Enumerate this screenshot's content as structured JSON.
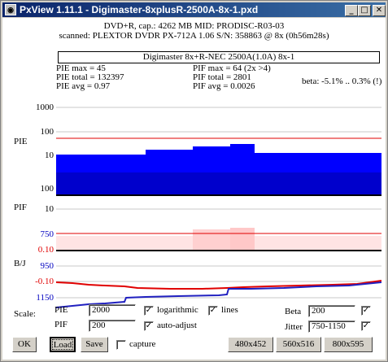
{
  "window": {
    "title": "PxView 1.11.1  -  Digimaster-8xplusR-2500A-8x-1.pxd",
    "app_icon": "disc-icon"
  },
  "header": {
    "line1": "DVD+R, cap.: 4262 MB MID: PRODISC-R03-03",
    "line2": "scanned: PLEXTOR DVDR PX-712A 1.06 S/N: 358863 @ 8x (0h56m28s)",
    "disc_label": "Digimaster 8x+R-NEC 2500A(1.0A) 8x-1"
  },
  "stats": {
    "pie_max": "PIE max = 45",
    "pie_total": "PIE total = 132397",
    "pie_avg": "PIE avg = 0.97",
    "pif_max": "PIF max = 64 (2x >4)",
    "pif_total": "PIF total = 2801",
    "pif_avg": "PIF avg = 0.0026",
    "beta": "beta: -5.1% .. 0.3% (!)"
  },
  "graph": {
    "pie_label": "PIE",
    "pif_label": "PIF",
    "bj_label": "B/J",
    "pie_ticks": [
      "1000",
      "100",
      "10"
    ],
    "pif_ticks": [
      "100",
      "10"
    ],
    "jitter_ticks": [
      "750",
      "950",
      "1150"
    ],
    "beta_ticks": [
      "0.10",
      "-0.10"
    ],
    "colors": {
      "pie": "#0000ff",
      "pif": "#ffc0c0",
      "limit": "#e00000",
      "jitter": "#0000c0",
      "beta": "#e00000"
    }
  },
  "controls": {
    "scale_label": "Scale:",
    "pie_label": "PIE",
    "pie_value": "2000",
    "pif_label": "PIF",
    "pif_value": "200",
    "logarithmic_label": "logarithmic",
    "logarithmic_checked": true,
    "lines_label": "lines",
    "lines_checked": true,
    "auto_adjust_label": "auto-adjust",
    "auto_adjust_checked": true,
    "beta_label": "Beta",
    "beta_value": "200",
    "beta_checked": true,
    "jitter_label": "Jitter",
    "jitter_value": "750-1150",
    "jitter_checked": true,
    "capture_label": "capture",
    "capture_checked": false
  },
  "buttons": {
    "ok": "OK",
    "load": "Load",
    "save": "Save",
    "size1": "480x452",
    "size2": "560x516",
    "size3": "800x595"
  }
}
